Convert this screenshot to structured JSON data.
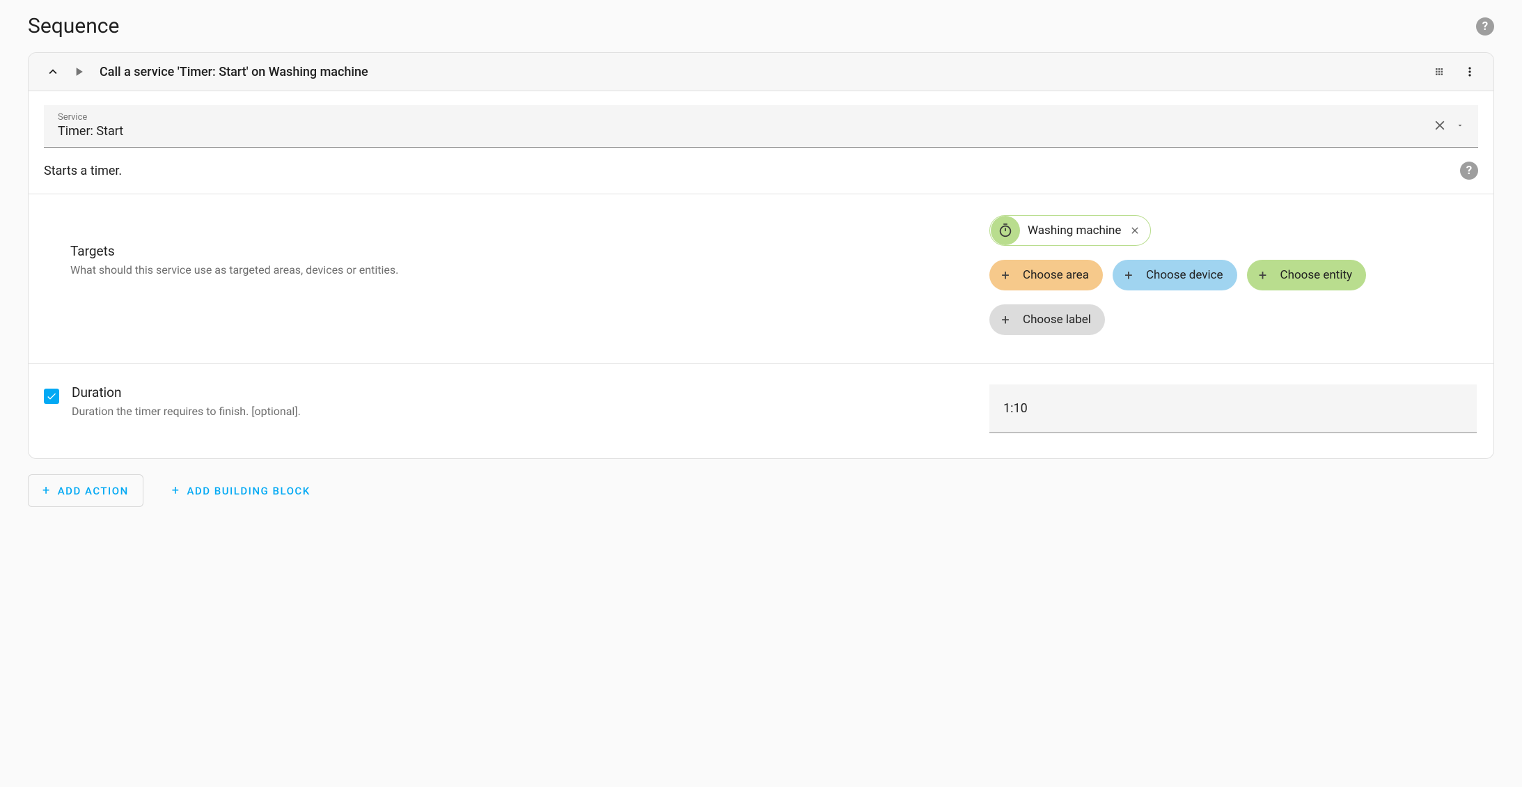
{
  "page": {
    "title": "Sequence"
  },
  "card": {
    "title": "Call a service 'Timer: Start' on Washing machine"
  },
  "service": {
    "label": "Service",
    "value": "Timer: Start",
    "description": "Starts a timer."
  },
  "targets": {
    "heading": "Targets",
    "subheading": "What should this service use as targeted areas, devices or entities.",
    "selected": "Washing machine",
    "choose_area": "Choose area",
    "choose_device": "Choose device",
    "choose_entity": "Choose entity",
    "choose_label": "Choose label"
  },
  "duration": {
    "heading": "Duration",
    "subheading": "Duration the timer requires to finish. [optional].",
    "value": "1:10"
  },
  "footer": {
    "add_action": "Add Action",
    "add_building_block": "Add Building Block"
  }
}
